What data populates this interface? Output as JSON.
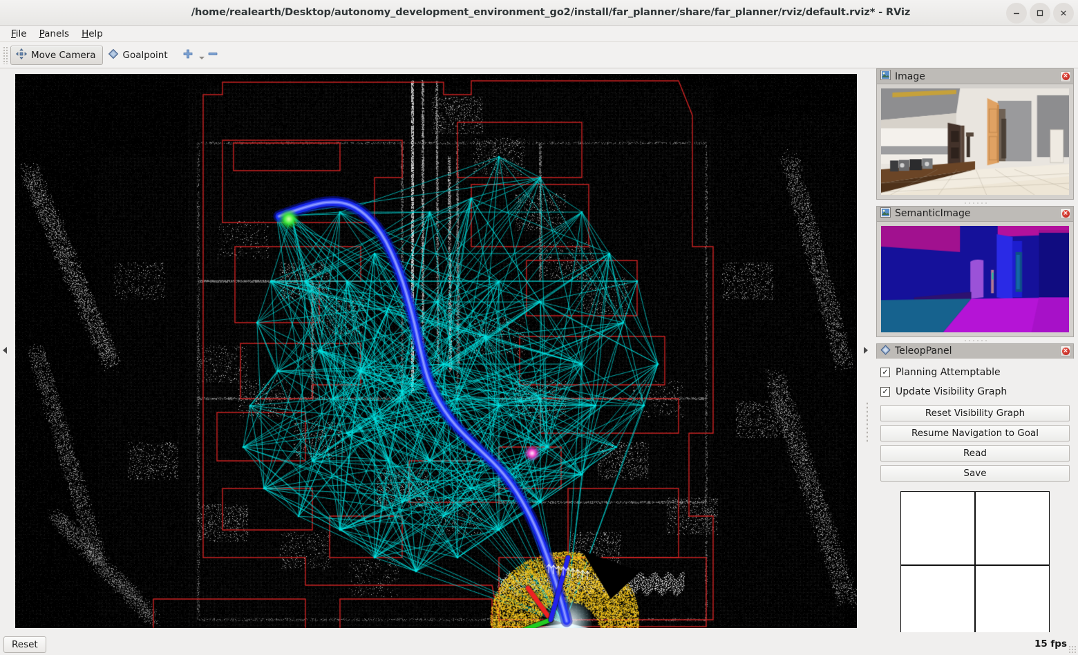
{
  "window": {
    "title": "/home/realearth/Desktop/autonomy_development_environment_go2/install/far_planner/share/far_planner/rviz/default.rviz* - RViz",
    "controls": [
      {
        "name": "minimize",
        "glyph": "—"
      },
      {
        "name": "maximize",
        "glyph": "□"
      },
      {
        "name": "close",
        "glyph": "×"
      }
    ]
  },
  "menubar": {
    "items": [
      {
        "label": "File",
        "mnemonic": "F"
      },
      {
        "label": "Panels",
        "mnemonic": "P"
      },
      {
        "label": "Help",
        "mnemonic": "H"
      }
    ]
  },
  "toolbar": {
    "move_camera": {
      "label": "Move Camera",
      "icon": "move-camera-icon",
      "checked": true
    },
    "goalpoint": {
      "label": "Goalpoint",
      "icon": "goalpoint-diamond-icon",
      "checked": false
    },
    "add_tool": {
      "label": "",
      "icon": "plus-icon"
    },
    "remove_tool": {
      "label": "",
      "icon": "minus-icon"
    }
  },
  "viewport": {
    "name": "rviz-3d-render-view",
    "background_color": "#000000",
    "pointcloud_color": "#b9b9b9",
    "polygon_color": "#cc2222",
    "visibility_graph_color": "#00e5e5",
    "path_color": "#1b2dff",
    "terrain_color": "#f5c518",
    "goal_marker_color": "#22dd22",
    "waypoint_marker_color": "#ee44cc",
    "robot_axis_x_color": "#ee2222",
    "robot_axis_y_color": "#22cc22",
    "robot_axis_z_color": "#2222ee"
  },
  "dock": {
    "panels": [
      {
        "title": "Image",
        "icon": "image-panel-icon",
        "close_label": "×",
        "type": "camera-image"
      },
      {
        "title": "SemanticImage",
        "icon": "image-panel-icon",
        "close_label": "×",
        "type": "semantic-image"
      },
      {
        "title": "TeleopPanel",
        "icon": "teleop-diamond-icon",
        "close_label": "×",
        "type": "teleop"
      }
    ]
  },
  "teleop": {
    "checkboxes": [
      {
        "label": "Planning Attemptable",
        "checked": true,
        "mark": "✓"
      },
      {
        "label": "Update Visibility Graph",
        "checked": true,
        "mark": "✓"
      }
    ],
    "buttons": [
      {
        "label": "Reset Visibility Graph"
      },
      {
        "label": "Resume Navigation to Goal"
      },
      {
        "label": "Read"
      },
      {
        "label": "Save"
      }
    ],
    "joystick": {
      "name": "teleop-joystick-grid",
      "cells": 4
    }
  },
  "statusbar": {
    "reset_label": "Reset",
    "fps_label": "15 fps"
  }
}
